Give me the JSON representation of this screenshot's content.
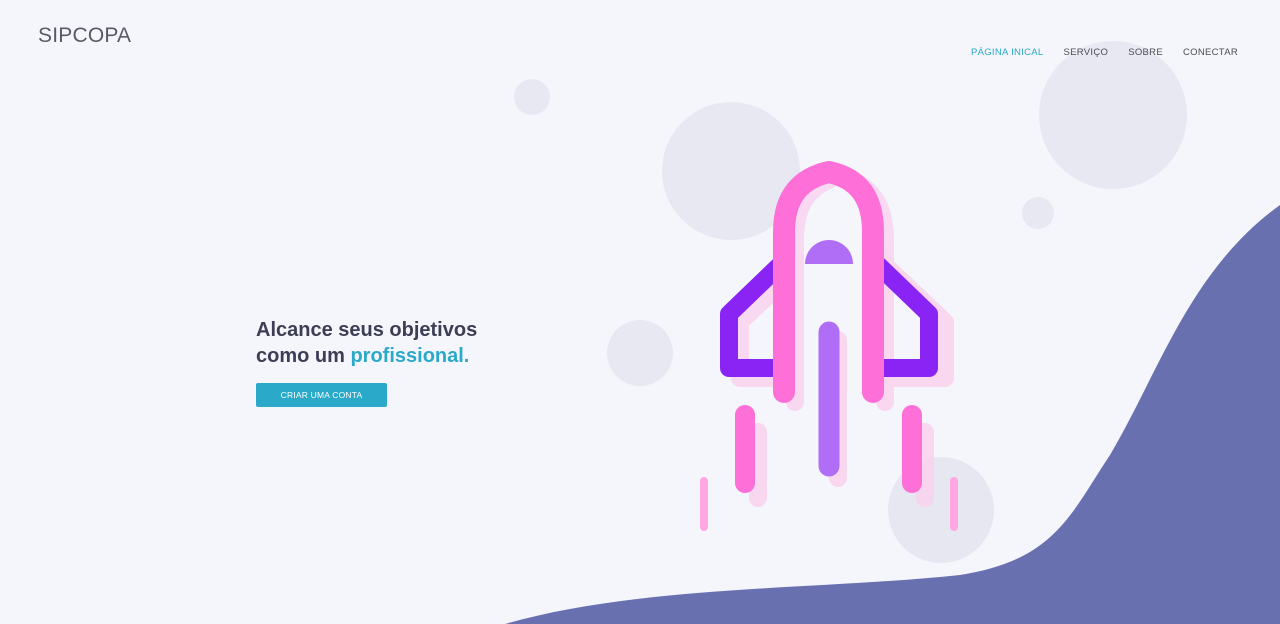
{
  "brand": {
    "name": "SIPCOPA"
  },
  "nav": {
    "items": [
      {
        "label": "PÁGINA INICAL",
        "active": true
      },
      {
        "label": "SERVIÇO",
        "active": false
      },
      {
        "label": "SOBRE",
        "active": false
      },
      {
        "label": "CONECTAR",
        "active": false
      }
    ]
  },
  "hero": {
    "title_line1": "Alcance seus objetivos",
    "title_line2_prefix": "como um ",
    "title_line2_accent": "profissional.",
    "cta_label": "CRIAR UMA CONTA"
  },
  "colors": {
    "background": "#f5f6fb",
    "accent": "#2aa9c9",
    "wave": "#6870b0",
    "rocket_body": "#ff6fd8",
    "rocket_wings": "#8a24f4",
    "bubble": "#e7e8f2"
  },
  "icons": {
    "illustration": "rocket-illustration"
  }
}
